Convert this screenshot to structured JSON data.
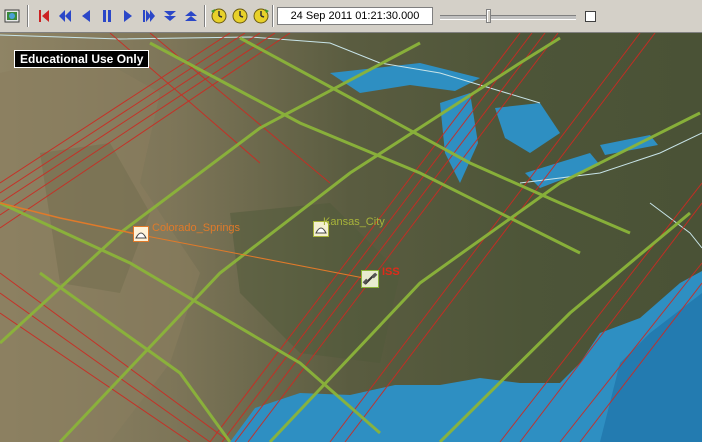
{
  "toolbar": {
    "icons": [
      "globe-window-icon",
      "skip-to-start-icon",
      "step-back-icon",
      "play-reverse-icon",
      "pause-icon",
      "play-icon",
      "step-forward-icon",
      "decrease-step-icon",
      "increase-step-icon",
      "clock-icon",
      "clock-icon",
      "clock-icon"
    ],
    "time_value": "24 Sep 2011 01:21:30.000",
    "colors": {
      "control_red": "#cc2222",
      "control_blue": "#2b47c8",
      "clock_yellow": "#e8d12a"
    }
  },
  "map": {
    "watermark": "Educational Use Only",
    "sites": [
      {
        "name": "Colorado_Springs",
        "display_text": "Colorado_Springs",
        "color": "#e07a2a",
        "icon": "facility-icon"
      },
      {
        "name": "Kansas_City",
        "display_text": "Kansas_City",
        "color": "#a8b43a",
        "icon": "facility-icon"
      },
      {
        "name": "ISS",
        "display_text": "ISS",
        "color": "#e02a1a",
        "icon": "satellite-icon"
      }
    ],
    "colors": {
      "ground_track_red": "#cc2a22",
      "ground_track_green": "#8bb43a",
      "access_line": "#e07a2a",
      "water": "#2e8fc2"
    }
  }
}
